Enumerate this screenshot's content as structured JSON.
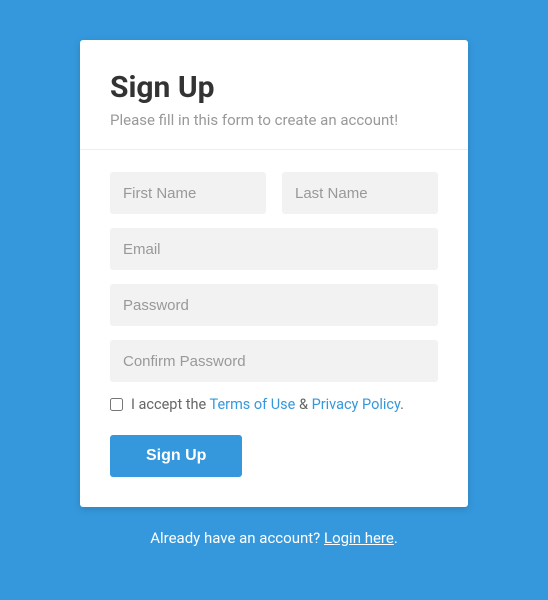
{
  "form": {
    "title": "Sign Up",
    "subtitle": "Please fill in this form to create an account!",
    "first_name_placeholder": "First Name",
    "last_name_placeholder": "Last Name",
    "email_placeholder": "Email",
    "password_placeholder": "Password",
    "confirm_password_placeholder": "Confirm Password",
    "terms": {
      "prefix": "I accept the ",
      "terms_link": "Terms of Use",
      "separator": " & ",
      "privacy_link": "Privacy Policy",
      "suffix": "."
    },
    "submit_label": "Sign Up"
  },
  "footer": {
    "text": "Already have an account? ",
    "link_text": "Login here",
    "suffix": "."
  }
}
